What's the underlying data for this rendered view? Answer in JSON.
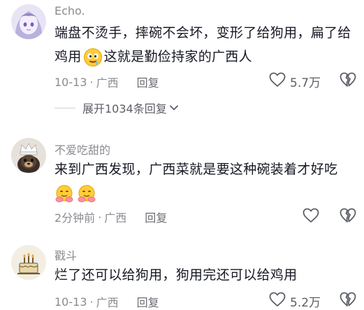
{
  "comments": [
    {
      "username": "Echo.",
      "text_part1": "端盘不烫手，摔碗不会坏，变形了给狗用，扁了给鸡用",
      "text_part2": "这就是勤俭持家的广西人",
      "emoji": "drooling-face-emoji",
      "time": "10-13",
      "location": "广西",
      "reply_label": "回复",
      "like_count": "5.7万"
    },
    {
      "username": "不爱吃甜的",
      "text": "来到广西发现，广西菜就是要这种碗装着才好吃",
      "emojis": [
        "hugging-face-emoji",
        "hugging-face-emoji"
      ],
      "time": "2分钟前",
      "location": "广西",
      "reply_label": "回复",
      "like_count": ""
    },
    {
      "username": "戳斗",
      "text": "烂了还可以给狗用，狗用完还可以给鸡用",
      "time": "10-13",
      "location": "广西",
      "reply_label": "回复",
      "like_count": "5.2万"
    }
  ],
  "expand_replies": {
    "label": "展开1034条回复"
  },
  "separator": "·",
  "colors": {
    "text_primary": "#161823",
    "text_secondary": "#8a8b91",
    "background": "#ffffff"
  }
}
